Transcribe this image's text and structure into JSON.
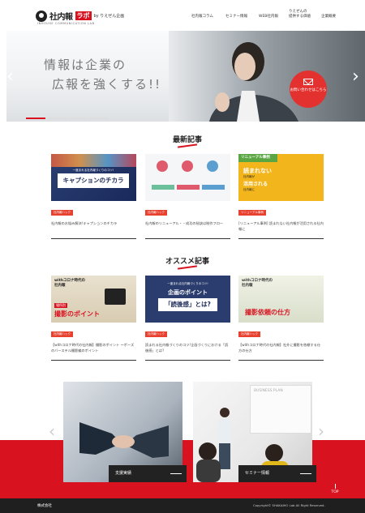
{
  "header": {
    "logo_text": "社内報",
    "logo_badge": "ラボ",
    "logo_by": "by りえぜん企画",
    "logo_sub": "INHOUSE COMMUNICATION LAB",
    "nav": [
      "社内報コラム",
      "セミナー情報",
      "WEB社内報",
      "りえぜんの\n提供する価値",
      "企業概要"
    ]
  },
  "hero": {
    "line1": "情報は企業の",
    "line2": "広報を強くする!!",
    "cta": "お問い合わせはこちら",
    "slides_active": 1,
    "slides_total": 4
  },
  "latest": {
    "title": "最新記事",
    "cards": [
      {
        "tag": "社内報ハック",
        "text": "社内報のお悩み解決!キャプションのチカラ",
        "img": {
          "sub": "一度まれる社内報づくりのコツ!",
          "title": "キャプションのチカラ"
        }
      },
      {
        "tag": "社内報ハック",
        "text": "社内報のリニューアル・・成功の秘訣は制作フロー",
        "img": {}
      },
      {
        "tag": "リニューアル事例",
        "text": "[リニューアル事例] 読まれない社内報が活用される社内報に",
        "img": {
          "head": "リニューアル事例",
          "l1": "読まれない",
          "l2": "社内報が",
          "l3": "活用される",
          "l4": "社内報に"
        }
      }
    ]
  },
  "recommend": {
    "title": "オススメ記事",
    "cards": [
      {
        "tag": "社内報ハック",
        "text": "【withコロナ時代の社内報】撮影のポイント 〜ポーズのバーステル撮影編のポイント",
        "img": {
          "l1": "withコロナ時代の",
          "l2": "社内報",
          "tag": "場所別",
          "title": "撮影のポイント"
        }
      },
      {
        "tag": "社内報ハック",
        "text": "読まれる社内報づくりのコツ!企画づくりにおける「読後感」とは?",
        "img": {
          "sub": "一度まれる社内報づくりのコツ!",
          "title": "企画のポイント",
          "box": "「読後感」とは?"
        }
      },
      {
        "tag": "社内報ハック",
        "text": "【withコロナ時代の社内報】社外に撮影を依頼する仕方の仕方",
        "img": {
          "l1": "withコロナ時代の",
          "l2": "社内報",
          "title": "撮影依頼の仕方"
        }
      }
    ]
  },
  "bottom_slider": {
    "slides": [
      {
        "label": "支援実績"
      },
      {
        "label": "セミナー情報",
        "board": "BUSINESS PLAN"
      }
    ]
  },
  "footer": {
    "company": "株式会社",
    "copyright": "Copyright© SHAKAIHO Lab All Right Reserved.",
    "top": "TOP"
  },
  "colors": {
    "accent": "#d9121f",
    "footer": "#1f1f1f"
  }
}
